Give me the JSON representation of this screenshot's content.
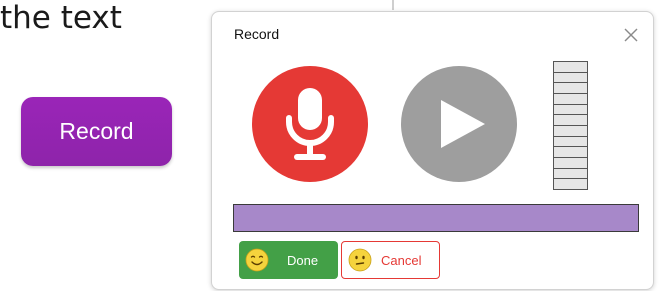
{
  "background": {
    "text": "the text",
    "record_button_label": "Record"
  },
  "dialog": {
    "title": "Record",
    "close_icon": "close-icon",
    "mic_button_icon": "microphone-icon",
    "play_button_icon": "play-icon",
    "level_meter_segments": 12,
    "progress_fraction": 1.0,
    "done_label": "Done",
    "cancel_label": "Cancel",
    "done_icon": "smiling-face-icon",
    "cancel_icon": "neutral-face-icon"
  },
  "colors": {
    "record_button": "#8e24aa",
    "mic_button": "#e53935",
    "play_button": "#9e9e9e",
    "progress_fill": "#a788c9",
    "done_button": "#43a047",
    "cancel_border": "#e53935",
    "emoji": "#f5d33d"
  }
}
